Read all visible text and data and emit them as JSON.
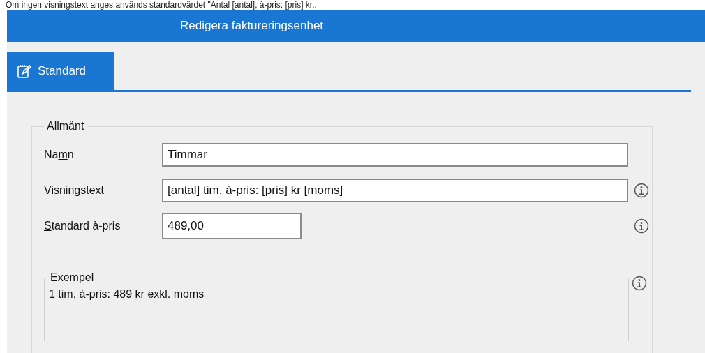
{
  "hint_text": "Om ingen visningstext anges används standardvärdet \"Antal [antal], à-pris: [pris] kr..",
  "window": {
    "title": "Redigera faktureringsenhet"
  },
  "tabs": [
    {
      "label": "Standard",
      "selected": true
    }
  ],
  "group": {
    "title": "Allmänt",
    "fields": [
      {
        "label_before": "Na",
        "label_key": "m",
        "label_after": "n",
        "value": "Timmar",
        "kind": "wide",
        "info": false
      },
      {
        "label_key": "V",
        "label_after": "isningstext",
        "value": "[antal] tim, à-pris: [pris] kr [moms]",
        "kind": "wide",
        "info": true
      },
      {
        "label_key": "S",
        "label_after": "tandard à-pris",
        "value": "489,00",
        "kind": "narrow",
        "info": true
      }
    ],
    "example": {
      "title": "Exempel",
      "text": "1 tim, à-pris: 489 kr exkl. moms",
      "info": true
    }
  }
}
